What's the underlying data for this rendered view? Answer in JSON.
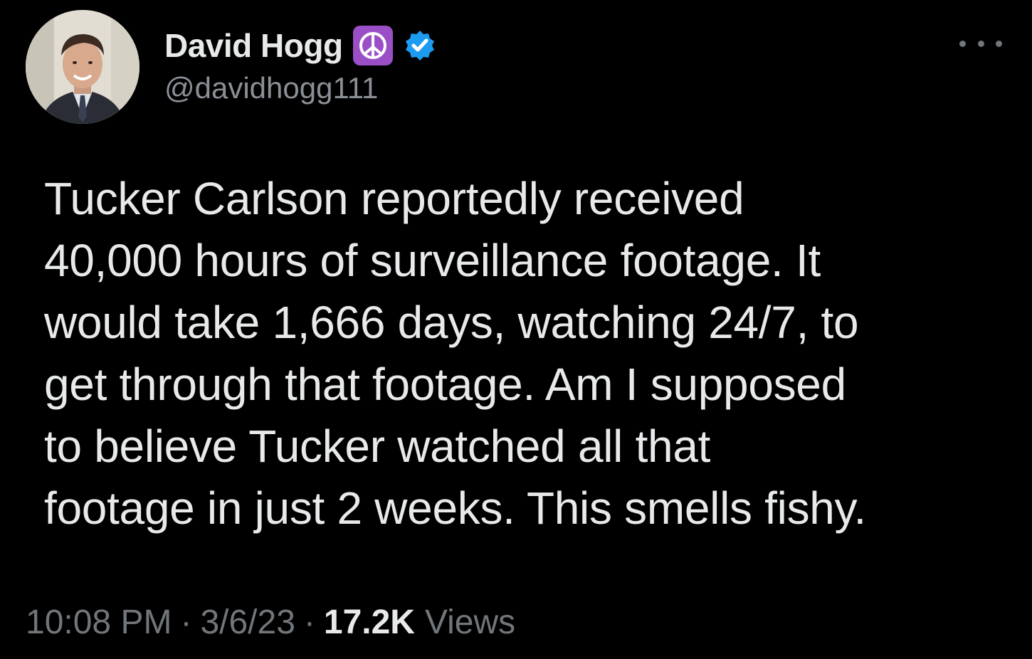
{
  "author": {
    "display_name": "David Hogg",
    "handle": "@davidhogg111",
    "emoji_badge": "peace-symbol",
    "verified": true,
    "verified_color": "#1d9bf0",
    "badge_color": "#9b4fc7"
  },
  "tweet": {
    "text_lines": [
      "Tucker Carlson reportedly received",
      "40,000 hours of surveillance footage. It",
      "would take 1,666 days, watching 24/7, to",
      "get through that footage. Am I supposed",
      "to believe Tucker watched all that",
      "footage in just 2 weeks. This smells fishy."
    ]
  },
  "meta": {
    "time": "10:08 PM",
    "separator": "·",
    "date": "3/6/23",
    "views_count": "17.2K",
    "views_label": "Views"
  },
  "icons": {
    "more": "more-horizontal-icon",
    "verified": "verified-badge-icon",
    "peace": "peace-symbol-icon"
  }
}
